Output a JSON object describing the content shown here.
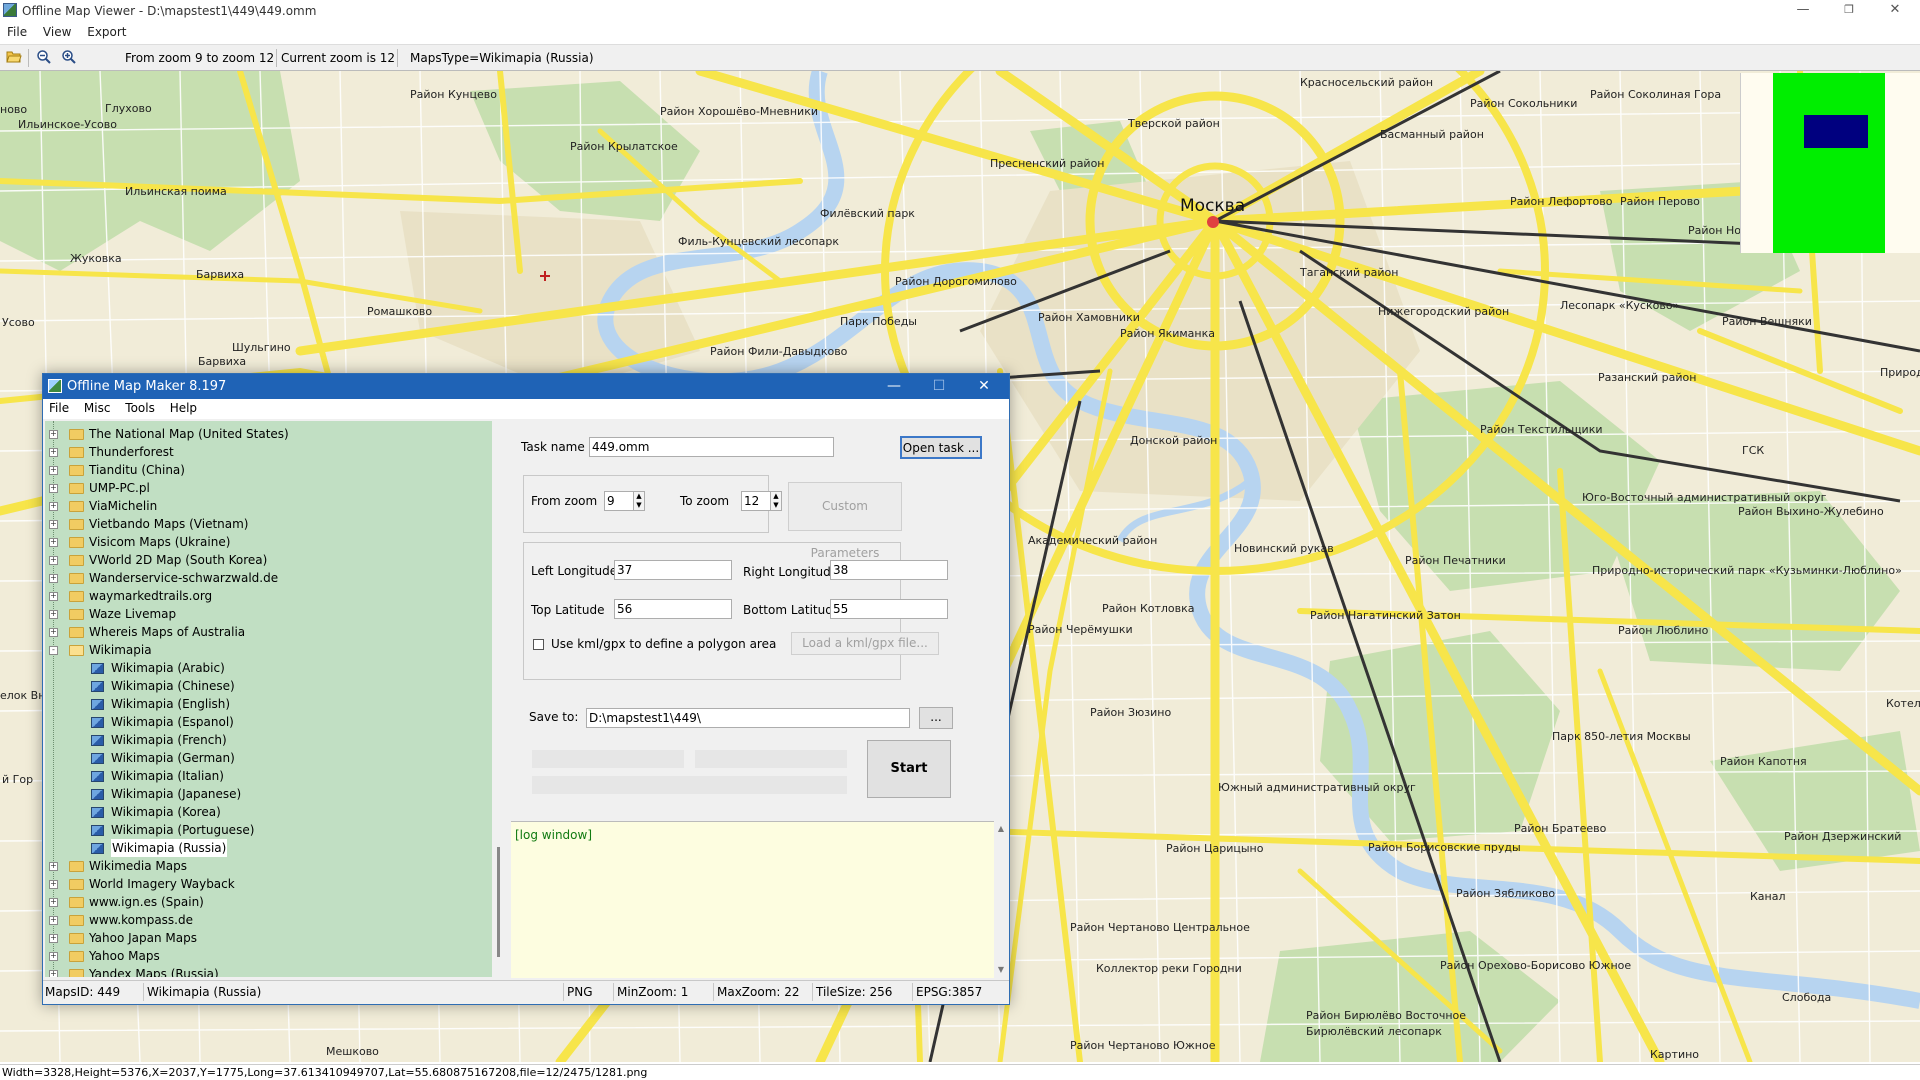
{
  "window": {
    "title": "Offline Map Viewer - D:\\mapstest1\\449\\449.omm",
    "controls": {
      "minimize": "—",
      "maximize": "❐",
      "close": "✕"
    }
  },
  "menu": [
    "File",
    "View",
    "Export"
  ],
  "toolbar": {
    "zoom_range": "From zoom 9 to zoom 12",
    "current_zoom": "Current zoom is 12",
    "maps_type": "MapsType=Wikimapia (Russia)"
  },
  "map_labels": [
    "Район Кунцево",
    "Район Хорошёво-Мневники",
    "Красносельский район",
    "Район Сокольники",
    "Район Соколиная Гора",
    "Глухово",
    "Ильинское-Усово",
    "Район Крылатское",
    "Тверской район",
    "Басманный район",
    "Пресненский район",
    "Ильинская поима",
    "Москва",
    "Район Лефортово",
    "Район Перово",
    "Жуковка",
    "Филёвский парк",
    "Филь-Кунцевский лесопарк",
    "Барвиха",
    "Район Дорогомилово",
    "Таганский район",
    "Район Но",
    "Усово",
    "Ромашково",
    "Парк Победы",
    "Район Хамовники",
    "Район Якиманка",
    "Нижегородский район",
    "Лесопарк «Кусково»",
    "Район Вешняки",
    "Шульгино",
    "Барвиха",
    "Район Фили-Давыдково",
    "Разанский район",
    "Природн",
    "Донской район",
    "Район Текстильщики",
    "ГСК",
    "Юго-Восточный административный округ",
    "Район Выхино-Жулебино",
    "Академический район",
    "Новинский рукав",
    "Район Печатники",
    "Природно-исторический парк «Кузьминки-Люблино»",
    "Район Котловка",
    "Район Нагатинский Затон",
    "Район Люблино",
    "Район Черёмушки",
    "Район Зюзино",
    "Парк 850-летия Москвы",
    "Котельн",
    "Район Капотня",
    "Южный административный округ",
    "Район Братеево",
    "Район Царицыно",
    "Район Борисовские пруды",
    "Район Дзержинский",
    "Район Зябликово",
    "Канал",
    "Район Чертаново Центральное",
    "Коллектор реки Городни",
    "Район Орехово-Борисово Южное",
    "Район Бирюлёво Восточное",
    "Бирюлёвский лесопарк",
    "Слобода",
    "Мешково",
    "Район Чертаново Южное",
    "Картино",
    "елок Вн",
    "й Гор",
    "ново"
  ],
  "status_line": "Width=3328,Height=5376,X=2037,Y=1775,Long=37.613410949707,Lat=55.680875167208,file=12/2475/1281.png",
  "dialog": {
    "title": "Offline Map Maker 8.197",
    "controls": {
      "minimize": "—",
      "maximize": "☐",
      "close": "✕"
    },
    "menu": [
      "File",
      "Misc",
      "Tools",
      "Help"
    ],
    "tree": [
      {
        "label": "The National Map (United States)",
        "expander": "+"
      },
      {
        "label": "Thunderforest",
        "expander": "+"
      },
      {
        "label": "Tianditu (China)",
        "expander": "+"
      },
      {
        "label": "UMP-PC.pl",
        "expander": "+"
      },
      {
        "label": "ViaMichelin",
        "expander": "+"
      },
      {
        "label": "Vietbando Maps (Vietnam)",
        "expander": "+"
      },
      {
        "label": "Visicom Maps (Ukraine)",
        "expander": "+"
      },
      {
        "label": "VWorld 2D Map (South Korea)",
        "expander": "+"
      },
      {
        "label": "Wanderservice-schwarzwald.de",
        "expander": "+"
      },
      {
        "label": "waymarkedtrails.org",
        "expander": "+"
      },
      {
        "label": "Waze Livemap",
        "expander": "+"
      },
      {
        "label": "Whereis Maps of Australia",
        "expander": "+"
      },
      {
        "label": "Wikimapia",
        "expander": "-",
        "expanded": true
      },
      {
        "label": "Wikimapia (Arabic)",
        "child": true
      },
      {
        "label": "Wikimapia (Chinese)",
        "child": true
      },
      {
        "label": "Wikimapia (English)",
        "child": true
      },
      {
        "label": "Wikimapia (Espanol)",
        "child": true
      },
      {
        "label": "Wikimapia (French)",
        "child": true
      },
      {
        "label": "Wikimapia (German)",
        "child": true
      },
      {
        "label": "Wikimapia (Italian)",
        "child": true
      },
      {
        "label": "Wikimapia (Japanese)",
        "child": true
      },
      {
        "label": "Wikimapia (Korea)",
        "child": true
      },
      {
        "label": "Wikimapia (Portuguese)",
        "child": true
      },
      {
        "label": "Wikimapia (Russia)",
        "child": true,
        "selected": true
      },
      {
        "label": "Wikimedia Maps",
        "expander": "+"
      },
      {
        "label": "World Imagery Wayback",
        "expander": "+"
      },
      {
        "label": "www.ign.es (Spain)",
        "expander": "+"
      },
      {
        "label": "www.kompass.de",
        "expander": "+"
      },
      {
        "label": "Yahoo Japan Maps",
        "expander": "+"
      },
      {
        "label": "Yahoo Maps",
        "expander": "+"
      },
      {
        "label": "Yandex Maps (Russia)",
        "expander": "+"
      }
    ],
    "task_name_label": "Task name",
    "task_name": "449.omm",
    "open_task": "Open task ...",
    "from_zoom_label": "From zoom",
    "from_zoom": "9",
    "to_zoom_label": "To zoom",
    "to_zoom": "12",
    "custom_params": "Custom Parameters",
    "left_lon_label": "Left Longitude",
    "left_lon": "37",
    "right_lon_label": "Right Longitude",
    "right_lon": "38",
    "top_lat_label": "Top Latitude",
    "top_lat": "56",
    "bottom_lat_label": "Bottom Latitude",
    "bottom_lat": "55",
    "kml_label": "Use kml/gpx to define a polygon area",
    "kml_button": "Load a kml/gpx file...",
    "save_to_label": "Save to:",
    "save_to": "D:\\mapstest1\\449\\",
    "browse": "...",
    "start": "Start",
    "log": "[log window]",
    "status": {
      "maps_id": "MapsID: 449",
      "maps_name": "Wikimapia (Russia)",
      "format": "PNG",
      "min_zoom": "MinZoom: 1",
      "max_zoom": "MaxZoom: 22",
      "tile_size": "TileSize: 256",
      "epsg": "EPSG:3857"
    }
  },
  "colors": {
    "map_background": "#f1ecd8",
    "major_road": "#f7e54a",
    "river": "#b7d4f0",
    "park": "#c7dfb0",
    "tree_background": "#c1dfc3",
    "dialog_titlebar": "#1f63b6",
    "overview_green": "#00ee00",
    "overview_viewport": "#00007f"
  },
  "icons": {
    "open": "folder-open-icon",
    "zoom_out": "zoom-out-icon",
    "zoom_in": "zoom-in-icon"
  }
}
